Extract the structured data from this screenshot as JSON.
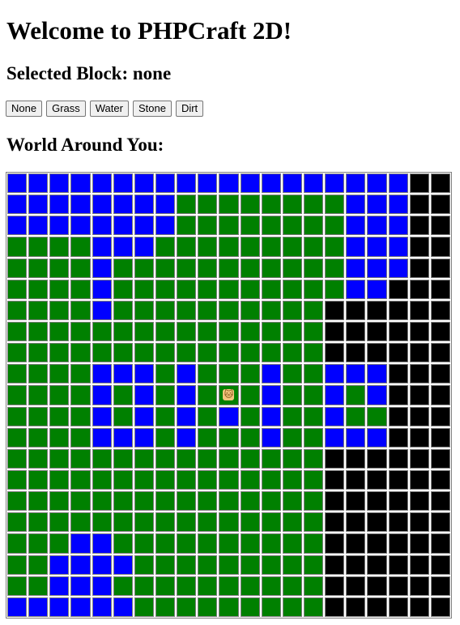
{
  "page": {
    "title": "Welcome to PHPCraft 2D!",
    "selected_label": "Selected Block: none",
    "world_label": "World Around You:"
  },
  "buttons": [
    {
      "label": "None"
    },
    {
      "label": "Grass"
    },
    {
      "label": "Water"
    },
    {
      "label": "Stone"
    },
    {
      "label": "Dirt"
    }
  ],
  "colors": {
    "W": "#0000ff",
    "G": "#008000",
    "S": "#000000",
    "grid_line": "#808080"
  },
  "block_names": {
    "W": "water",
    "G": "grass",
    "S": "stone"
  },
  "player": {
    "icon": "cat-icon",
    "glyph": "🐱"
  },
  "world": {
    "rows": [
      "WWWWWWWWWWWWWWWWWWWSS",
      "WWWWWWWWGGGGGGGGWWWSS",
      "WWWWWWWWGGGGGGGGWWWSS",
      "GGGGWWWGGGGGGGGGWWWSS",
      "GGGGWGGGGGGGGGGGWWWSS",
      "GGGGWGGGGGGGGGGGWWSSS",
      "GGGGWGGGGGGGGGGSSSSSS",
      "GGGGGGGGGGGGGGGSSSSSS",
      "GGGGGGGGGGGGGGGSSSSSS",
      "GGGGWWWGWGGGWGGWWWSSS",
      "GGGGWGWGWGPGWGGWGWSSS",
      "GGGGWGWGWGWGWGGWGGSSS",
      "GGGGWWWGWGGGWGGWWWSSS",
      "GGGGGGGGGGGGGGGSSSSSS",
      "GGGGGGGGGGGGGGGSSSSSS",
      "GGGGGGGGGGGGGGGSSSSSS",
      "GGGGGGGGGGGGGGGSSSSSS",
      "GGGWWGGGGGGGGGGSSSSSS",
      "GGWWWWGGGGGGGGGSSSSSS",
      "GGWWWGGGGGGGGGGSSSSSS",
      "WWWWWWGGGGGGGGGSSSSSS"
    ]
  }
}
